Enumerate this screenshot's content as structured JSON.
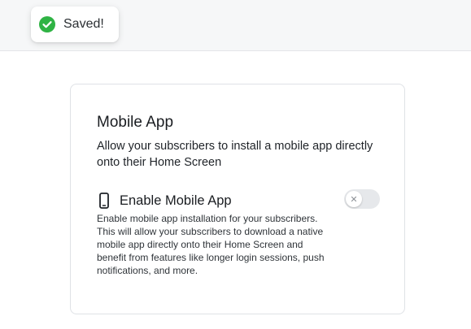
{
  "toast": {
    "icon": "check-circle-icon",
    "message": "Saved!",
    "color": "#2fb344"
  },
  "card": {
    "title": "Mobile App",
    "description": "Allow your subscribers to install a mobile app directly onto their Home Screen",
    "setting": {
      "icon": "smartphone-icon",
      "label": "Enable Mobile App",
      "help": "Enable mobile app installation for your subscribers. This will allow your subscribers to download a native mobile app directly onto their Home Screen and benefit from features like longer login sessions, push notifications, and more.",
      "toggle": {
        "enabled": false,
        "off_glyph": "✕"
      }
    }
  }
}
